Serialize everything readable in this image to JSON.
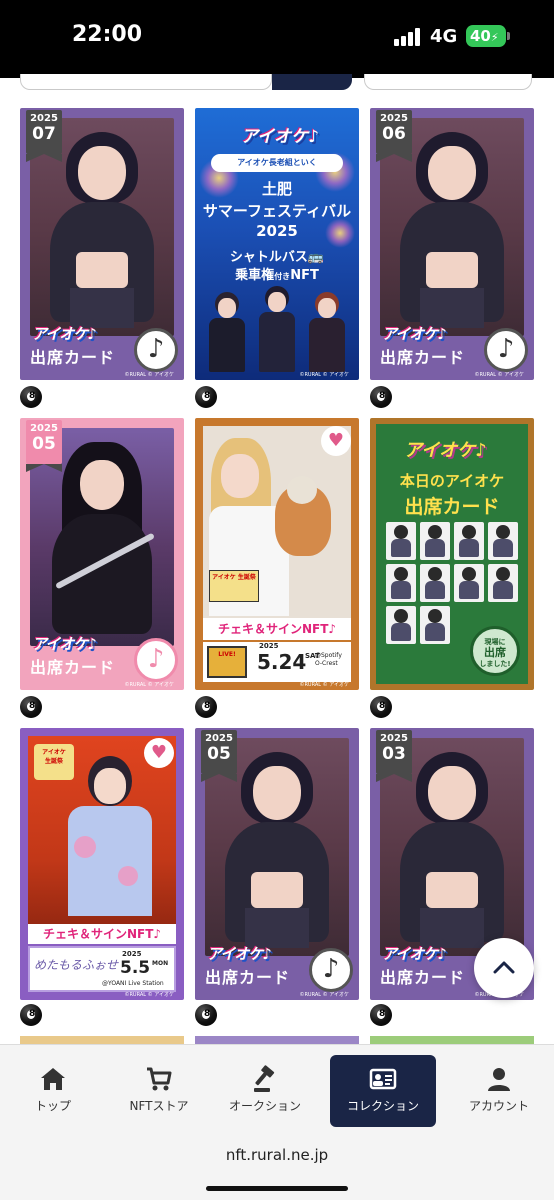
{
  "status": {
    "time": "22:00",
    "network": "4G",
    "battery": "40"
  },
  "grid": {
    "cards": [
      {
        "type": "attendance",
        "year": "2025",
        "month": "07",
        "logo": "アイオケ♪",
        "title": "出席カード",
        "copy": "©RURAL © アイオケ",
        "chip": "8",
        "theme": "#7a5fa6"
      },
      {
        "type": "festival",
        "logo": "アイオケ♪",
        "subtitle": "アイオケ長老組といく",
        "line1": "土肥",
        "line2": "サマーフェスティバル",
        "line3": "2025",
        "line4": "シャトルバス🚌",
        "line5": "乗車権",
        "line5_small": "付き",
        "line5_tail": "NFT",
        "copy": "©RURAL © アイオケ",
        "chip": "8"
      },
      {
        "type": "attendance",
        "year": "2025",
        "month": "06",
        "logo": "アイオケ♪",
        "title": "出席カード",
        "copy": "©RURAL © アイオケ",
        "chip": "8",
        "theme": "#7a5fa6"
      },
      {
        "type": "attendance",
        "year": "2025",
        "month": "05",
        "logo": "アイオケ♪",
        "title": "出席カード",
        "copy": "©RURAL © アイオケ",
        "chip": "8",
        "theme": "#f2a4bd"
      },
      {
        "type": "cheki",
        "band": "チェキ＆サインNFT♪",
        "year": "2025",
        "date": "5.24",
        "dow": "SAT",
        "venue1": "@Spotify",
        "venue2": "O-Crest",
        "mini_logo": "アイオケ 生誕祭",
        "copy": "©RURAL © アイオケ",
        "chip": "8",
        "heart": "♥"
      },
      {
        "type": "green",
        "logo": "アイオケ♪",
        "line1": "本日のアイオケ",
        "line2": "出席カード",
        "stamp1": "現場に",
        "stamp2": "出席",
        "stamp3": "しました!",
        "chip": "8"
      },
      {
        "type": "yukata",
        "band": "チェキ＆サインNFT♪",
        "sign": "めたもるふぉせ",
        "year": "2025",
        "date": "5.5",
        "dow": "MON",
        "venue": "@YOANI Live Station",
        "copy": "©RURAL © アイオケ",
        "chip": "8",
        "heart": "♥"
      },
      {
        "type": "attendance",
        "year": "2025",
        "month": "05",
        "logo": "アイオケ♪",
        "title": "出席カード",
        "copy": "©RURAL © アイオケ",
        "chip": "8",
        "theme": "#7a5fa6"
      },
      {
        "type": "attendance",
        "year": "2025",
        "month": "03",
        "logo": "アイオケ♪",
        "title": "出席カード",
        "copy": "©RURAL © アイオケ",
        "chip": "8",
        "theme": "#7a5fa6"
      }
    ]
  },
  "nav": {
    "items": [
      {
        "label": "トップ",
        "icon": "home-icon",
        "active": false
      },
      {
        "label": "NFTストア",
        "icon": "cart-icon",
        "active": false
      },
      {
        "label": "オークション",
        "icon": "gavel-icon",
        "active": false
      },
      {
        "label": "コレクション",
        "icon": "collection-icon",
        "active": true
      },
      {
        "label": "アカウント",
        "icon": "user-icon",
        "active": false
      }
    ]
  },
  "browser": {
    "url": "nft.rural.ne.jp"
  },
  "colors": {
    "nav_active": "#1a2546",
    "accent_pink": "#e0247a"
  }
}
